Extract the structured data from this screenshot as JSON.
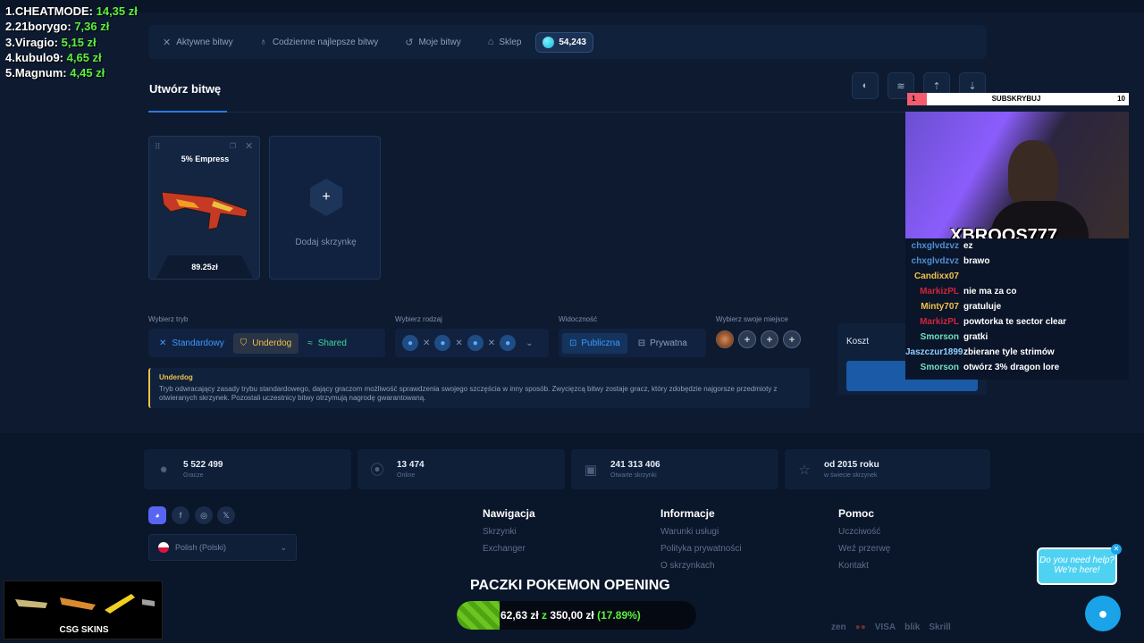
{
  "nav": {
    "items": [
      {
        "label": "Aktywne bitwy",
        "icon": "swords-icon"
      },
      {
        "label": "Codzienne najlepsze bitwy",
        "icon": "trophy-icon"
      },
      {
        "label": "Moje bitwy",
        "icon": "history-icon"
      },
      {
        "label": "Sklep",
        "icon": "basket-icon"
      }
    ],
    "balance": "54,243"
  },
  "page": {
    "title": "Utwórz bitwę"
  },
  "cases": [
    {
      "name": "5% Empress",
      "price": "89.25zł"
    }
  ],
  "add_case_label": "Dodaj skrzynkę",
  "settings": {
    "mode_label": "Wybierz tryb",
    "modes": [
      "Standardowy",
      "Underdog",
      "Shared"
    ],
    "kind_label": "Wybierz rodzaj",
    "visibility_label": "Widoczność",
    "visibility": [
      "Publiczna",
      "Prywatna"
    ],
    "seat_label": "Wybierz swoje miejsce"
  },
  "info": {
    "title": "Underdog",
    "text": "Tryb odwracający zasady trybu standardowego, dający graczom możliwość sprawdzenia swojego szczęścia w inny sposób. Zwycięzcą bitwy zostaje gracz, który zdobędzie najgorsze przedmioty z otwieranych skrzynek. Pozostali uczestnicy bitwy otrzymują nagrodę gwarantowaną."
  },
  "cost": {
    "label": "Koszt"
  },
  "stats": [
    {
      "value": "5 522 499",
      "label": "Gracze",
      "icon": "user-icon"
    },
    {
      "value": "13 474",
      "label": "Online",
      "icon": "signal-icon"
    },
    {
      "value": "241 313 406",
      "label": "Otwarte skrzynki",
      "icon": "box-icon"
    },
    {
      "value": "od 2015 roku",
      "label": "w świecie skrzynek",
      "icon": "star-icon"
    }
  ],
  "language": "Polish (Polski)",
  "footer": {
    "nav": {
      "title": "Nawigacja",
      "links": [
        "Skrzynki",
        "Exchanger"
      ]
    },
    "info": {
      "title": "Informacje",
      "links": [
        "Warunki usługi",
        "Polityka prywatności",
        "O skrzynkach"
      ]
    },
    "help": {
      "title": "Pomoc",
      "links": [
        "Uczciwość",
        "Weź przerwę",
        "Kontakt"
      ]
    }
  },
  "leaderboard": [
    {
      "name": "1.CHEATMODE:",
      "value": "14,35 zł"
    },
    {
      "name": "2.21borygo:",
      "value": "7,36 zł"
    },
    {
      "name": "3.Viragio:",
      "value": "5,15 zł"
    },
    {
      "name": "4.kubulo9:",
      "value": "4,65 zł"
    },
    {
      "name": "5.Magnum:",
      "value": "4,45 zł"
    }
  ],
  "stream": {
    "sub_count_left": "1",
    "sub_label": "SUBSKRYBUJ",
    "sub_count_right": "10",
    "streamer": "XBROOS777"
  },
  "chat": [
    {
      "name": "chxglvdzvz",
      "msg": "ez",
      "color": "#4f8fd6"
    },
    {
      "name": "chxglvdzvz",
      "msg": "brawo",
      "color": "#4f8fd6"
    },
    {
      "name": "Candixx07",
      "msg": "",
      "color": "#f0c24a"
    },
    {
      "name": "MarkizPL",
      "msg": "nie ma za co",
      "color": "#d0243a"
    },
    {
      "name": "Minty707",
      "msg": "gratuluje",
      "color": "#f0c24a"
    },
    {
      "name": "MarkizPL",
      "msg": "powtorka te sector clear",
      "color": "#d0243a"
    },
    {
      "name": "Smorson",
      "msg": "gratki",
      "color": "#6fe0c0"
    },
    {
      "name": "Jaszczur1899",
      "msg": "zbierane tyle strimów",
      "color": "#8fd0ff"
    },
    {
      "name": "Smorson",
      "msg": "otwórz 3% dragon lore",
      "color": "#6fe0c0"
    }
  ],
  "overlay": {
    "title": "PACZKI POKEMON OPENING",
    "progress_text": "62,63 zł",
    "progress_mid": "z",
    "progress_goal": "350,00 zł",
    "progress_pct": "(17.89%)",
    "progress_fraction": 0.1789
  },
  "csg_label": "CSG SKINS",
  "help_bubble": {
    "line1": "Do you need help?",
    "line2": "We're here!"
  },
  "payments": [
    "zen",
    "VISA",
    "blik",
    "Skrill"
  ]
}
